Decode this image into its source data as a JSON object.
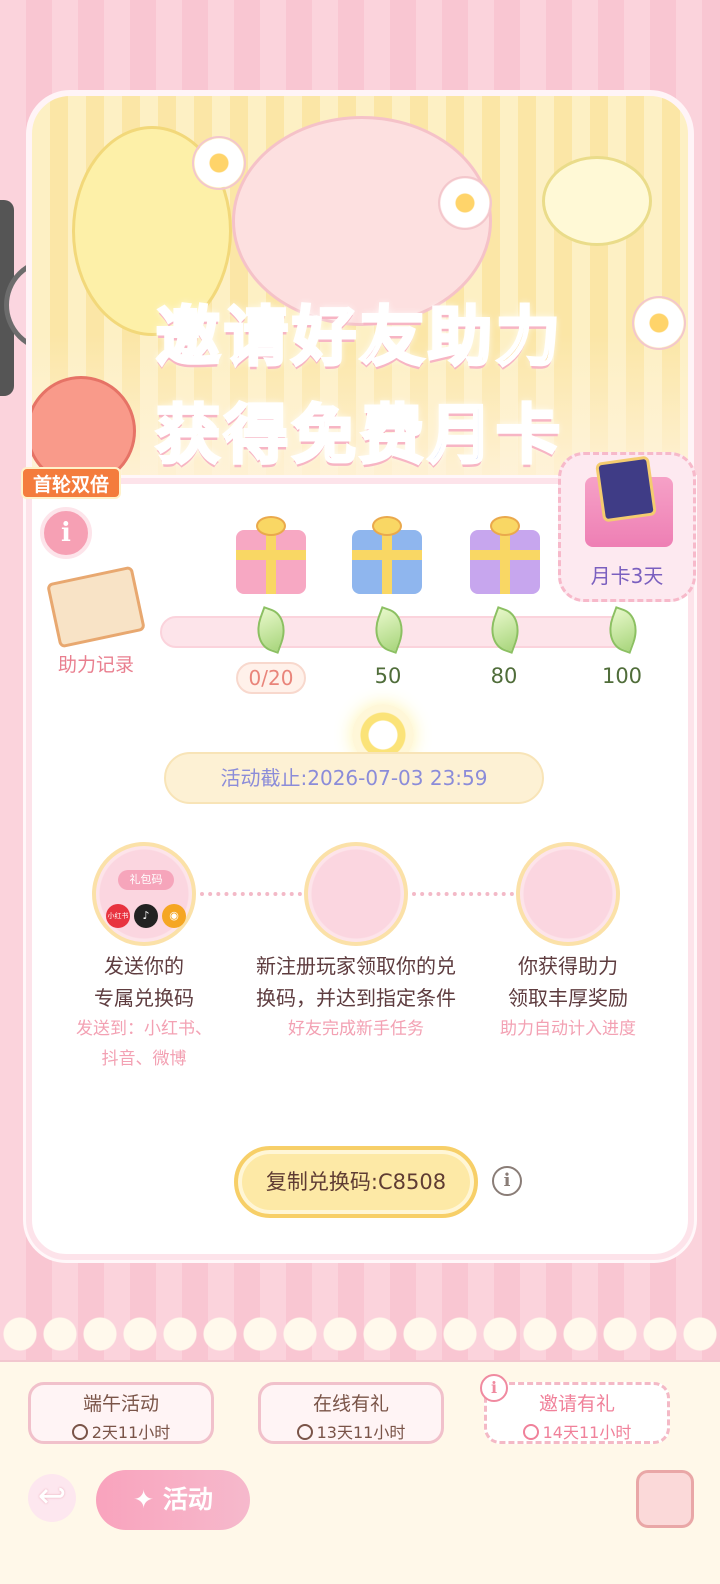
{
  "banner": {
    "line1": [
      {
        "text": "邀请好友",
        "tone": "pink"
      },
      {
        "text": "助力",
        "tone": "gold"
      }
    ],
    "line2": [
      {
        "text": "获得",
        "tone": "gold"
      },
      {
        "text": "免费",
        "tone": "pink"
      },
      {
        "text": "月卡",
        "tone": "blue"
      }
    ],
    "badge": "首轮双倍"
  },
  "record": {
    "label": "助力记录"
  },
  "progress": {
    "current": "0/20",
    "milestones": [
      "50",
      "80",
      "100"
    ],
    "final_reward": "月卡3天"
  },
  "deadline": "活动截止:2026-07-03 23:59",
  "steps": [
    {
      "title_line1": "发送你的",
      "title_line2": "专属兑换码",
      "sub_line1": "发送到：小红书、",
      "sub_line2": "抖音、微博",
      "logos": [
        "小红书"
      ]
    },
    {
      "title_line1": "新注册玩家领取你的兑",
      "title_line2": "换码，并达到指定条件",
      "sub_line1": "好友完成新手任务"
    },
    {
      "title_line1": "你获得助力",
      "title_line2": "领取丰厚奖励",
      "sub_line1": "助力自动计入进度"
    }
  ],
  "gift_label": "礼包码",
  "copy_button": "复制兑换码:C8508",
  "tabs": [
    {
      "title": "端午活动",
      "time": "2天11小时",
      "active": false
    },
    {
      "title": "在线有礼",
      "time": "13天11小时",
      "active": false
    },
    {
      "title": "邀请有礼",
      "time": "14天11小时",
      "active": true
    }
  ],
  "bottom": {
    "activity": "活动"
  },
  "colors": {
    "pink": "#f3627f",
    "gold": "#f6b432",
    "blue": "#6f8ef0",
    "accent": "#f0819a"
  },
  "icons": [
    "info-icon",
    "clock-icon",
    "back-arrow-icon",
    "sparkle-icon",
    "calendar-icon",
    "gift-icon",
    "leaf-icon"
  ]
}
